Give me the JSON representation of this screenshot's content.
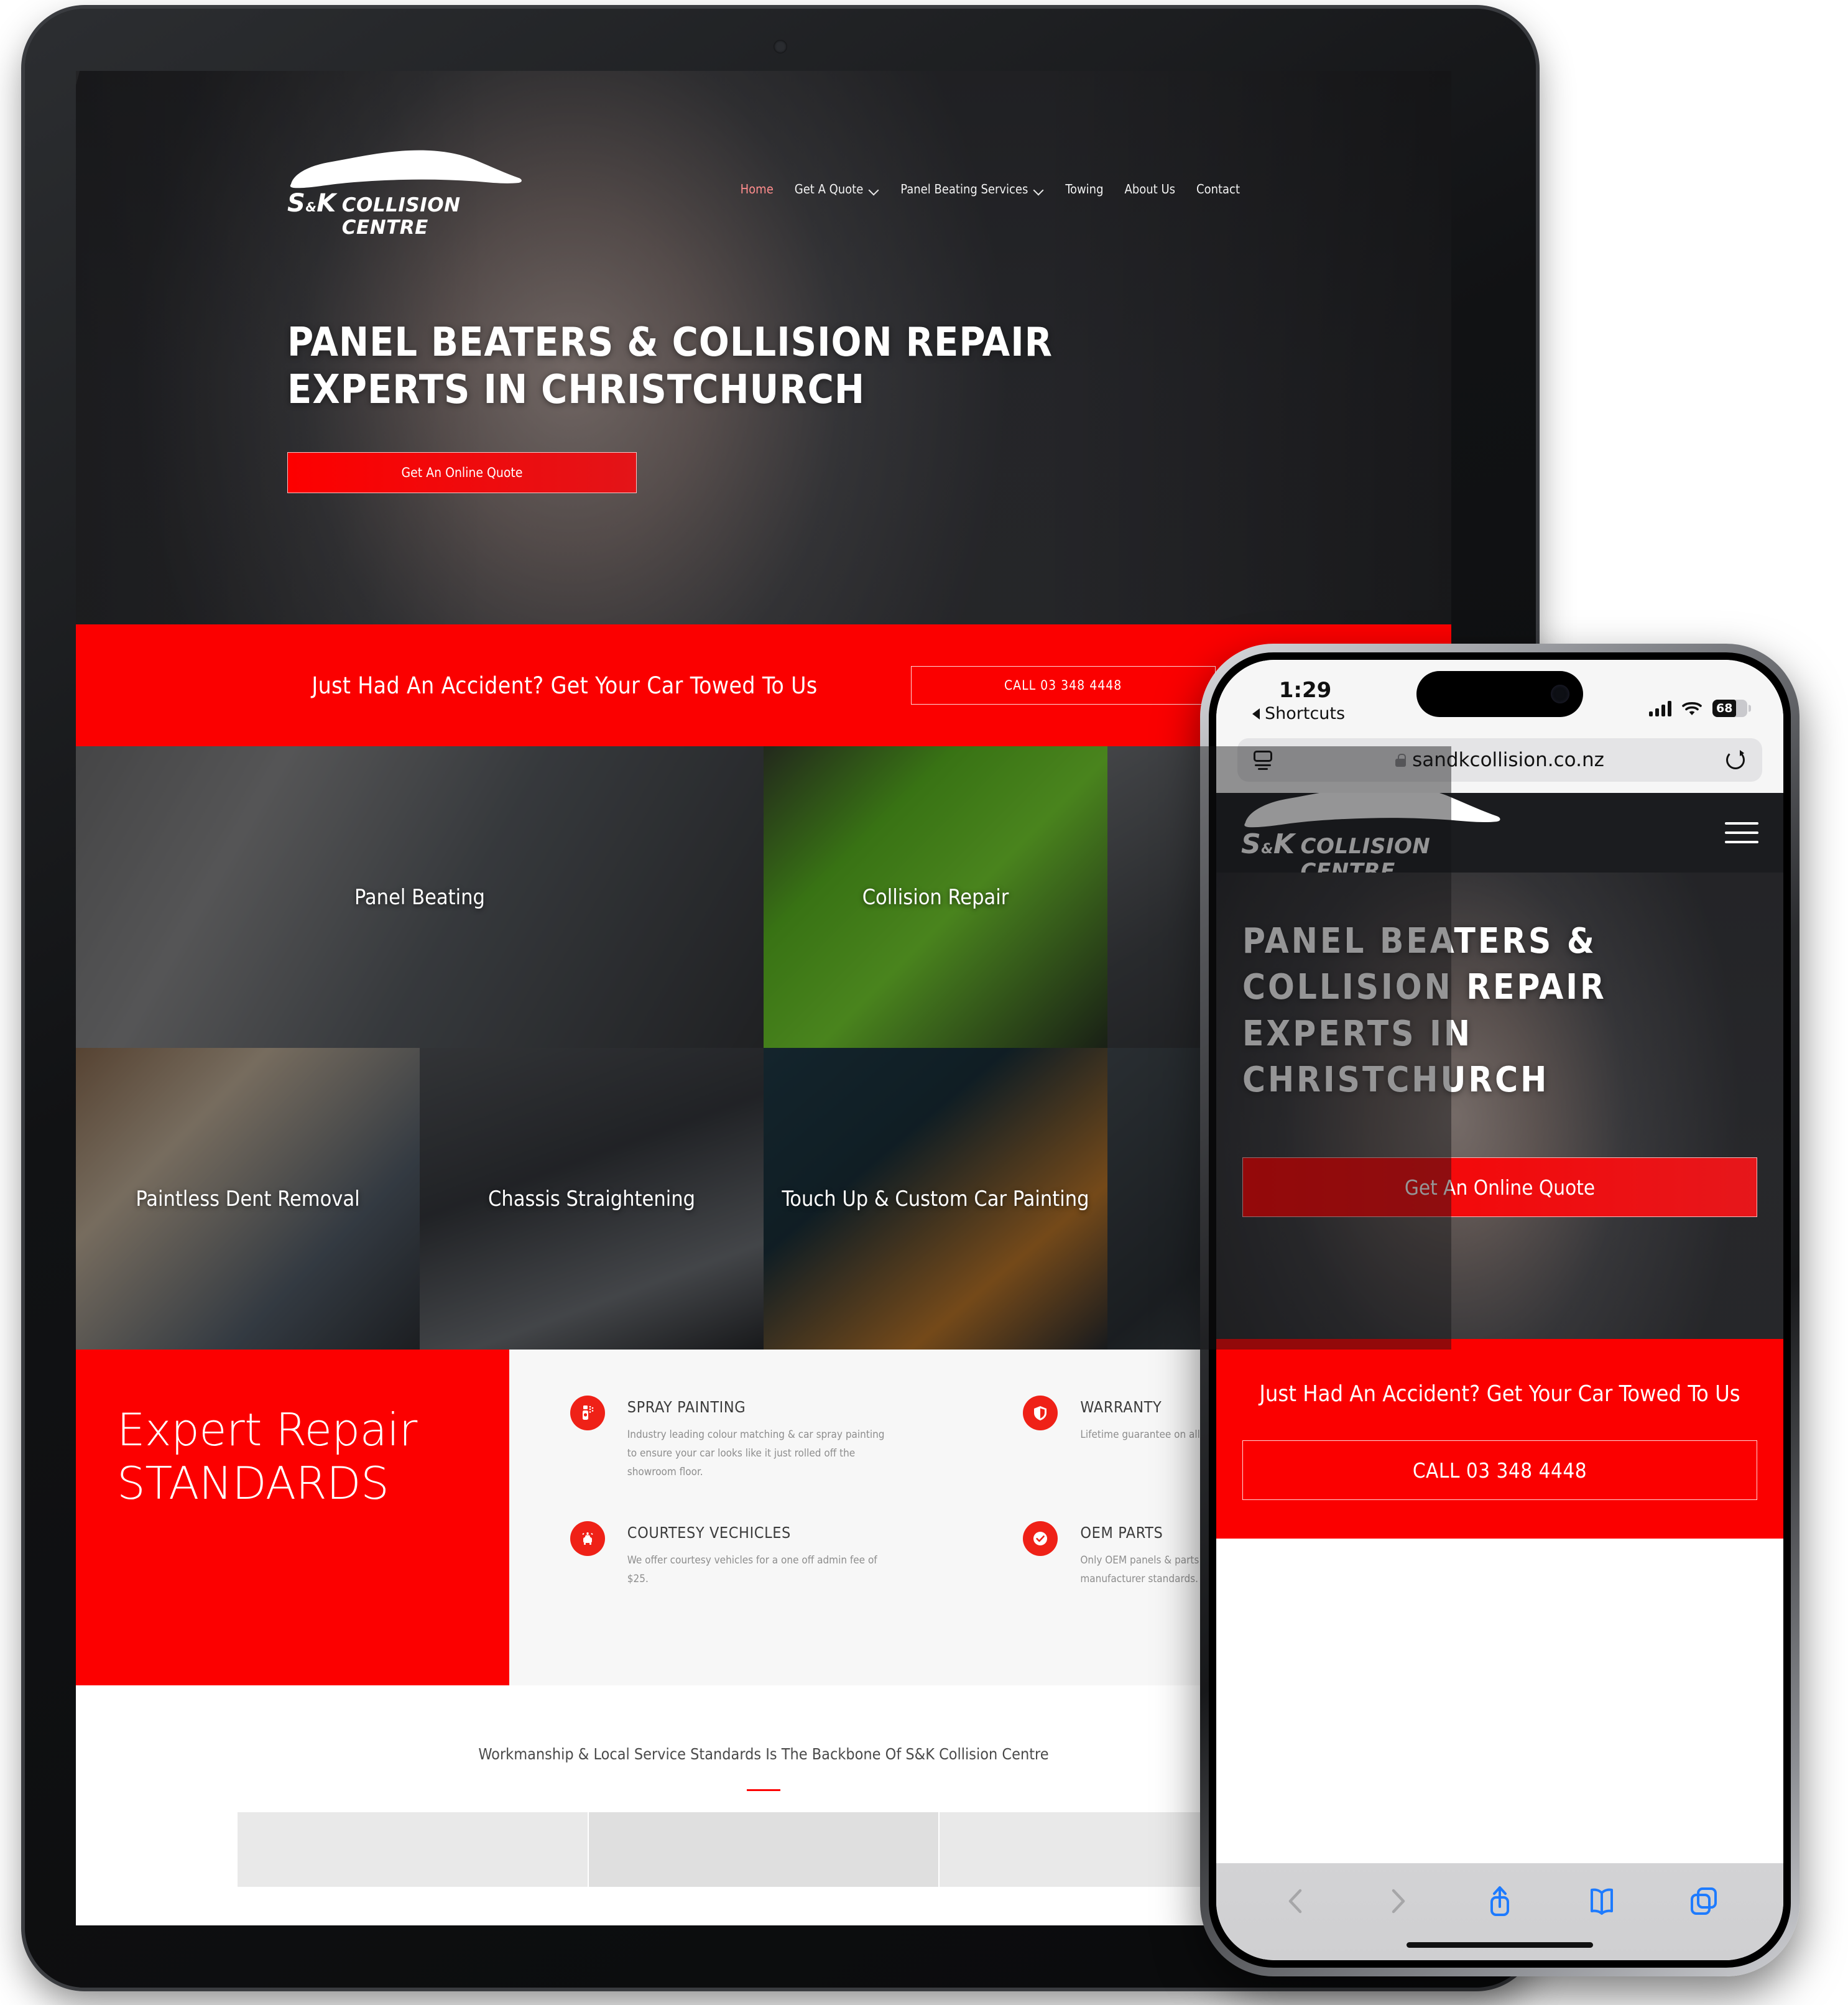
{
  "site": {
    "brand": {
      "sk": "S",
      "amp": "&",
      "k": "K",
      "rest": "COLLISION CENTRE",
      "logo_icon": "car-silhouette-icon"
    },
    "nav": [
      {
        "label": "Home",
        "active": true,
        "chevron": false
      },
      {
        "label": "Get A Quote",
        "active": false,
        "chevron": true
      },
      {
        "label": "Panel Beating Services",
        "active": false,
        "chevron": true
      },
      {
        "label": "Towing",
        "active": false,
        "chevron": false
      },
      {
        "label": "About Us",
        "active": false,
        "chevron": false
      },
      {
        "label": "Contact",
        "active": false,
        "chevron": false
      }
    ],
    "hero": {
      "heading": "PANEL BEATERS & COLLISION REPAIR\nEXPERTS IN CHRISTCHURCH",
      "cta_label": "Get An Online Quote"
    },
    "towing_band": {
      "text": "Just Had An Accident? Get Your Car Towed To Us",
      "button_label": "CALL 03 348 4448"
    },
    "services": [
      {
        "label": "Panel Beating"
      },
      {
        "label": "Collision Repair"
      },
      {
        "label": ""
      },
      {
        "label": "Paintless Dent Removal"
      },
      {
        "label": "Chassis Straightening"
      },
      {
        "label": "Touch Up & Custom Car Painting"
      },
      {
        "label": ""
      }
    ],
    "standards": {
      "heading": "Expert Repair\nSTANDARDS",
      "features": [
        {
          "icon": "spray-can-icon",
          "title": "SPRAY PAINTING",
          "desc": "Industry leading colour matching & car spray painting to ensure your car looks like it just rolled off the showroom floor."
        },
        {
          "icon": "shield-icon",
          "title": "WARRANTY",
          "desc": "Lifetime guarantee on all workmanship."
        },
        {
          "icon": "courtesy-car-icon",
          "title": "COURTESY VECHICLES",
          "desc": "We offer courtesy vehicles for a one off admin fee of $25."
        },
        {
          "icon": "check-badge-icon",
          "title": "OEM PARTS",
          "desc": "Only OEM panels & parts are used to ensure manufacturer standards."
        }
      ]
    },
    "footer": {
      "tagline": "Workmanship & Local Service Standards Is The Backbone Of S&K Collision Centre"
    }
  },
  "phone": {
    "status": {
      "time": "1:29",
      "back_label": "Shortcuts",
      "back_icon": "triangle-left-icon",
      "signal_icon": "cellular-bars-icon",
      "wifi_icon": "wifi-icon",
      "battery_level": "68",
      "battery_icon": "battery-icon"
    },
    "browser": {
      "reader_icon": "page-settings-icon",
      "lock_icon": "lock-icon",
      "url": "sandkcollision.co.nz",
      "reload_icon": "reload-icon",
      "toolbar": [
        {
          "name": "back-icon",
          "enabled": false
        },
        {
          "name": "forward-icon",
          "enabled": false
        },
        {
          "name": "share-icon",
          "enabled": true
        },
        {
          "name": "bookmarks-icon",
          "enabled": true
        },
        {
          "name": "tabs-icon",
          "enabled": true
        }
      ]
    },
    "site": {
      "menu_icon": "hamburger-menu-icon",
      "heading": "PANEL BEATERS &\nCOLLISION REPAIR\nEXPERTS IN\nCHRISTCHURCH",
      "cta_label": "Get An Online Quote",
      "band_text": "Just Had An Accident? Get Your Car Towed To Us",
      "band_button_label": "CALL 03 348 4448"
    }
  },
  "colors": {
    "brand_red": "#fb0000",
    "icon_red": "#ef2117",
    "nav_active": "#ff8d8d",
    "ios_blue": "#1e7bff"
  }
}
